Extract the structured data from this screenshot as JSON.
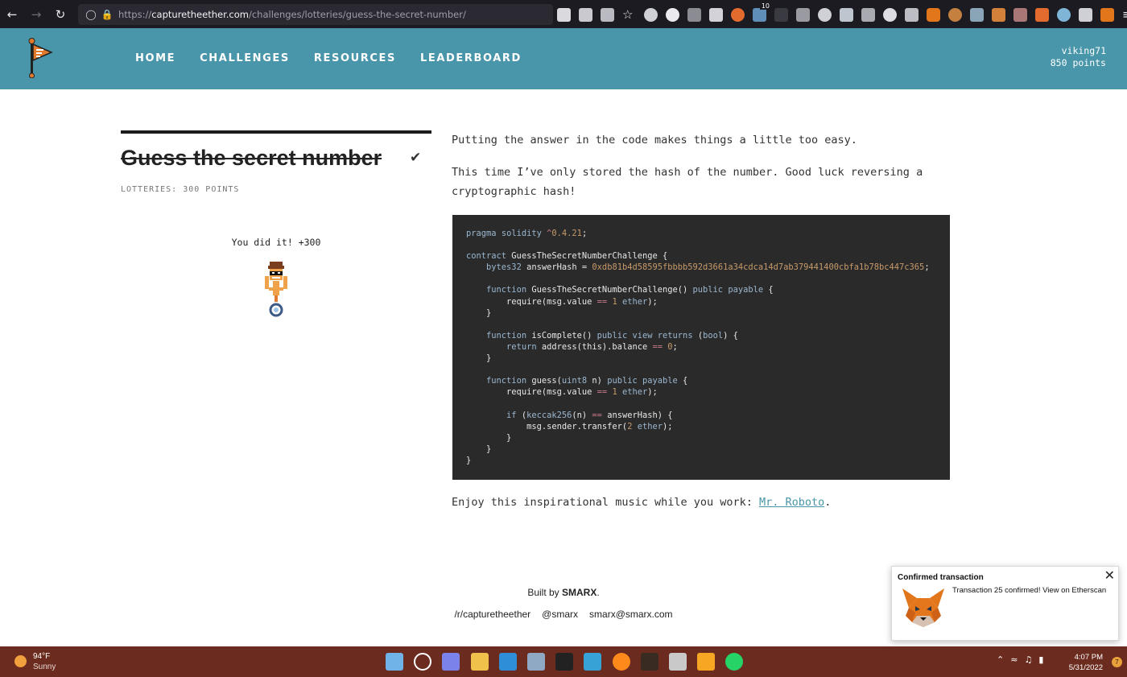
{
  "browser": {
    "url_domain": "capturetheether.com",
    "url_prefix": "https://",
    "url_path": "/challenges/lotteries/guess-the-secret-number/",
    "extension_badge": "10"
  },
  "site": {
    "nav": [
      "HOME",
      "CHALLENGES",
      "RESOURCES",
      "LEADERBOARD"
    ],
    "username": "viking71",
    "points": "850 points"
  },
  "challenge": {
    "title": "Guess the secret number",
    "meta": "LOTTERIES: 300 POINTS",
    "success": "You did it! +300",
    "para1": "Putting the answer in the code makes things a little too easy.",
    "para2": "This time I’ve only stored the hash of the number. Good luck reversing a cryptographic hash!",
    "music_prefix": "Enjoy this inspirational music while you work: ",
    "music_link": "Mr. Roboto",
    "music_suffix": "."
  },
  "code": {
    "lines": [
      "pragma solidity ^0.4.21;",
      "",
      "contract GuessTheSecretNumberChallenge {",
      "    bytes32 answerHash = 0xdb81b4d58595fbbbb592d3661a34cdca14d7ab379441400cbfa1b78bc447c365;",
      "",
      "    function GuessTheSecretNumberChallenge() public payable {",
      "        require(msg.value == 1 ether);",
      "    }",
      "",
      "    function isComplete() public view returns (bool) {",
      "        return address(this).balance == 0;",
      "    }",
      "",
      "    function guess(uint8 n) public payable {",
      "        require(msg.value == 1 ether);",
      "",
      "        if (keccak256(n) == answerHash) {",
      "            msg.sender.transfer(2 ether);",
      "        }",
      "    }",
      "}"
    ]
  },
  "footer": {
    "built_prefix": "Built by ",
    "built_name": "SMARX",
    "built_suffix": ".",
    "links": [
      "/r/capturetheether",
      "@smarx",
      "smarx@smarx.com"
    ]
  },
  "notification": {
    "title": "Confirmed transaction",
    "body": "Transaction 25 confirmed! View on Etherscan"
  },
  "taskbar": {
    "temp": "94°F",
    "weather": "Sunny",
    "time": "4:07 PM",
    "date": "5/31/2022",
    "notification_count": "7"
  },
  "colors": {
    "header": "#4995a9",
    "code_bg": "#2a2a2a",
    "taskbar": "#6b2c1f"
  }
}
